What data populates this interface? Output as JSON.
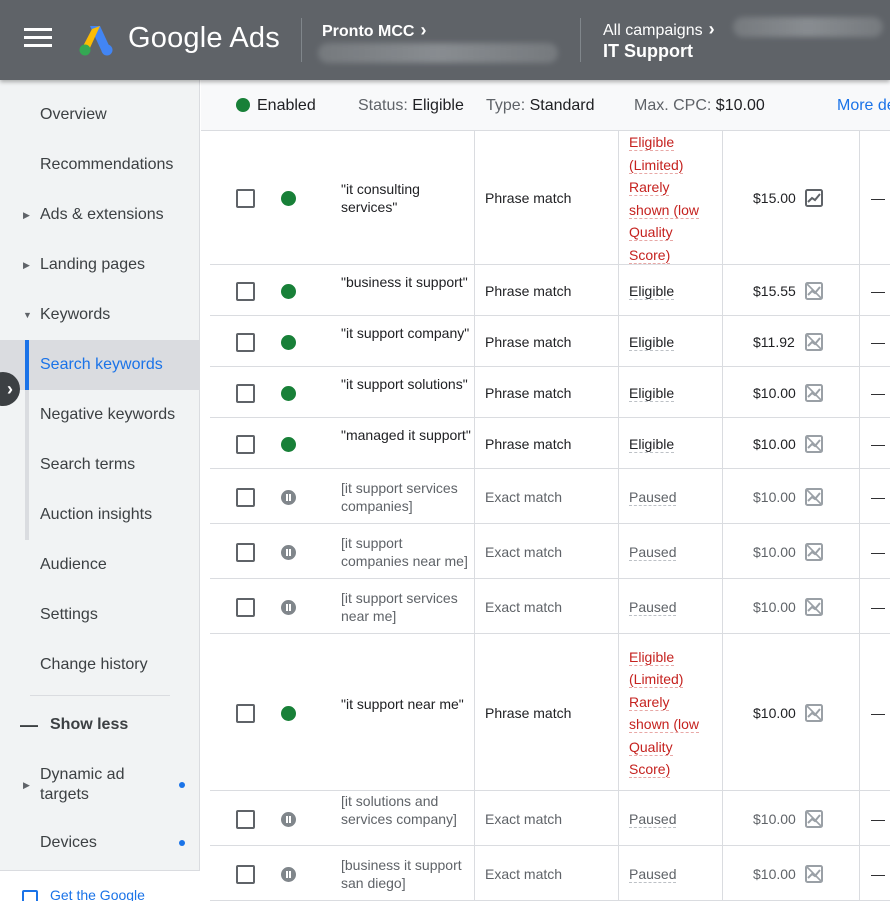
{
  "header": {
    "brand": "Google Ads",
    "account": "Pronto MCC",
    "campaigns_label": "All campaigns",
    "campaign_name": "IT Support"
  },
  "colors": {
    "header_bg": "#5f6368",
    "accent": "#1a73e8",
    "enabled": "#188038",
    "limited": "#c5221f",
    "paused": "#80868b"
  },
  "sidebar": {
    "items": [
      {
        "label": "Overview"
      },
      {
        "label": "Recommendations"
      },
      {
        "label": "Ads & extensions"
      },
      {
        "label": "Landing pages"
      },
      {
        "label": "Keywords"
      },
      {
        "label": "Search keywords"
      },
      {
        "label": "Negative keywords"
      },
      {
        "label": "Search terms"
      },
      {
        "label": "Auction insights"
      },
      {
        "label": "Audience"
      },
      {
        "label": "Settings"
      },
      {
        "label": "Change history"
      },
      {
        "label": "Show less"
      },
      {
        "label": "Dynamic ad targets"
      },
      {
        "label": "Devices"
      }
    ],
    "footer_link": "Get the Google"
  },
  "status_bar": {
    "enabled": "Enabled",
    "status_label": "Status:",
    "status_value": "Eligible",
    "type_label": "Type:",
    "type_value": "Standard",
    "cpc_label": "Max. CPC:",
    "cpc_value": "$10.00",
    "more": "More de"
  },
  "rows": [
    {
      "status": "enabled",
      "keyword": "\"it consulting services\"",
      "match": "Phrase match",
      "state": "Eligible (Limited) Rarely shown (low Quality Score)",
      "bid": "$15.00",
      "icon": "chart-icon",
      "dash": "—"
    },
    {
      "status": "enabled",
      "keyword": "\"business it support\"",
      "match": "Phrase match",
      "state": "Eligible",
      "bid": "$15.55",
      "icon": "chart-disabled-icon",
      "dash": "—"
    },
    {
      "status": "enabled",
      "keyword": "\"it support company\"",
      "match": "Phrase match",
      "state": "Eligible",
      "bid": "$11.92",
      "icon": "chart-disabled-icon",
      "dash": "—"
    },
    {
      "status": "enabled",
      "keyword": "\"it support solutions\"",
      "match": "Phrase match",
      "state": "Eligible",
      "bid": "$10.00",
      "icon": "chart-disabled-icon",
      "dash": "—"
    },
    {
      "status": "enabled",
      "keyword": "\"managed it support\"",
      "match": "Phrase match",
      "state": "Eligible",
      "bid": "$10.00",
      "icon": "chart-disabled-icon",
      "dash": "—"
    },
    {
      "status": "paused",
      "keyword": "[it support services companies]",
      "match": "Exact match",
      "state": "Paused",
      "bid": "$10.00",
      "icon": "chart-disabled-icon",
      "dash": "—"
    },
    {
      "status": "paused",
      "keyword": "[it support companies near me]",
      "match": "Exact match",
      "state": "Paused",
      "bid": "$10.00",
      "icon": "chart-disabled-icon",
      "dash": "—"
    },
    {
      "status": "paused",
      "keyword": "[it support services near me]",
      "match": "Exact match",
      "state": "Paused",
      "bid": "$10.00",
      "icon": "chart-disabled-icon",
      "dash": "—"
    },
    {
      "status": "enabled",
      "keyword": "\"it support near me\"",
      "match": "Phrase match",
      "state": "Eligible (Limited) Rarely shown (low Quality Score)",
      "bid": "$10.00",
      "icon": "chart-disabled-icon",
      "dash": "—"
    },
    {
      "status": "paused",
      "keyword": "[it solutions and services company]",
      "match": "Exact match",
      "state": "Paused",
      "bid": "$10.00",
      "icon": "chart-disabled-icon",
      "dash": "—"
    },
    {
      "status": "paused",
      "keyword": "[business it support san diego]",
      "match": "Exact match",
      "state": "Paused",
      "bid": "$10.00",
      "icon": "chart-disabled-icon",
      "dash": "—"
    }
  ]
}
